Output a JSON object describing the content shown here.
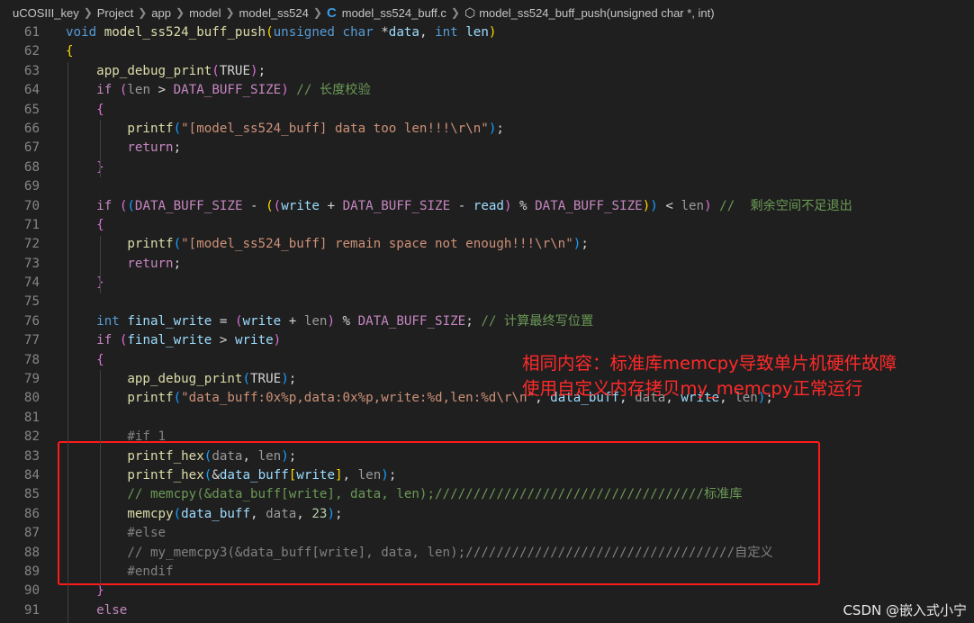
{
  "breadcrumb": {
    "segments": [
      "uCOSIII_key",
      "Project",
      "app",
      "model",
      "model_ss524",
      "model_ss524_buff.c",
      "model_ss524_buff_push(unsigned char *, int)"
    ]
  },
  "code": [
    {
      "n": "61",
      "t": [
        [
          "kw",
          "void"
        ],
        [
          "plain",
          " "
        ],
        [
          "fnn",
          "model_ss524_buff_push"
        ],
        [
          "brk1",
          "("
        ],
        [
          "kw",
          "unsigned"
        ],
        [
          "plain",
          " "
        ],
        [
          "kw",
          "char"
        ],
        [
          "plain",
          " *"
        ],
        [
          "var",
          "data"
        ],
        [
          "plain",
          ", "
        ],
        [
          "kw",
          "int"
        ],
        [
          "plain",
          " "
        ],
        [
          "var",
          "len"
        ],
        [
          "brk1",
          ")"
        ]
      ]
    },
    {
      "n": "62",
      "t": [
        [
          "brk1",
          "{"
        ]
      ]
    },
    {
      "n": "63",
      "t": [
        [
          "plain",
          "    "
        ],
        [
          "fnn",
          "app_debug_print"
        ],
        [
          "brk2",
          "("
        ],
        [
          "plain",
          "TRUE"
        ],
        [
          "brk2",
          ")"
        ],
        [
          "plain",
          ";"
        ]
      ]
    },
    {
      "n": "64",
      "t": [
        [
          "plain",
          "    "
        ],
        [
          "ctl",
          "if"
        ],
        [
          "plain",
          " "
        ],
        [
          "brk2",
          "("
        ],
        [
          "dim",
          "len"
        ],
        [
          "plain",
          " > "
        ],
        [
          "mac",
          "DATA_BUFF_SIZE"
        ],
        [
          "brk2",
          ")"
        ],
        [
          "plain",
          " "
        ],
        [
          "cmt",
          "// 长度校验"
        ]
      ]
    },
    {
      "n": "65",
      "t": [
        [
          "plain",
          "    "
        ],
        [
          "brk2",
          "{"
        ]
      ]
    },
    {
      "n": "66",
      "t": [
        [
          "plain",
          "        "
        ],
        [
          "fnn",
          "printf"
        ],
        [
          "brk3",
          "("
        ],
        [
          "str",
          "\"[model_ss524_buff] data too len!!!\\r\\n\""
        ],
        [
          "brk3",
          ")"
        ],
        [
          "plain",
          ";"
        ]
      ]
    },
    {
      "n": "67",
      "t": [
        [
          "plain",
          "        "
        ],
        [
          "ctl",
          "return"
        ],
        [
          "plain",
          ";"
        ]
      ]
    },
    {
      "n": "68",
      "t": [
        [
          "plain",
          "    "
        ],
        [
          "brk2",
          "}"
        ]
      ]
    },
    {
      "n": "69",
      "t": []
    },
    {
      "n": "70",
      "t": [
        [
          "plain",
          "    "
        ],
        [
          "ctl",
          "if"
        ],
        [
          "plain",
          " "
        ],
        [
          "brk2",
          "("
        ],
        [
          "brk3",
          "("
        ],
        [
          "mac",
          "DATA_BUFF_SIZE"
        ],
        [
          "plain",
          " - "
        ],
        [
          "brk1",
          "("
        ],
        [
          "brk2",
          "("
        ],
        [
          "var",
          "write"
        ],
        [
          "plain",
          " + "
        ],
        [
          "mac",
          "DATA_BUFF_SIZE"
        ],
        [
          "plain",
          " - "
        ],
        [
          "var",
          "read"
        ],
        [
          "brk2",
          ")"
        ],
        [
          "plain",
          " % "
        ],
        [
          "mac",
          "DATA_BUFF_SIZE"
        ],
        [
          "brk1",
          ")"
        ],
        [
          "brk3",
          ")"
        ],
        [
          "plain",
          " < "
        ],
        [
          "dim",
          "len"
        ],
        [
          "brk2",
          ")"
        ],
        [
          "plain",
          " "
        ],
        [
          "cmt",
          "//  剩余空间不足退出"
        ]
      ]
    },
    {
      "n": "71",
      "t": [
        [
          "plain",
          "    "
        ],
        [
          "brk2",
          "{"
        ]
      ]
    },
    {
      "n": "72",
      "t": [
        [
          "plain",
          "        "
        ],
        [
          "fnn",
          "printf"
        ],
        [
          "brk3",
          "("
        ],
        [
          "str",
          "\"[model_ss524_buff] remain space not enough!!!\\r\\n\""
        ],
        [
          "brk3",
          ")"
        ],
        [
          "plain",
          ";"
        ]
      ]
    },
    {
      "n": "73",
      "t": [
        [
          "plain",
          "        "
        ],
        [
          "ctl",
          "return"
        ],
        [
          "plain",
          ";"
        ]
      ]
    },
    {
      "n": "74",
      "t": [
        [
          "plain",
          "    "
        ],
        [
          "brk2",
          "}"
        ]
      ]
    },
    {
      "n": "75",
      "t": []
    },
    {
      "n": "76",
      "t": [
        [
          "plain",
          "    "
        ],
        [
          "kw",
          "int"
        ],
        [
          "plain",
          " "
        ],
        [
          "var",
          "final_write"
        ],
        [
          "plain",
          " = "
        ],
        [
          "brk2",
          "("
        ],
        [
          "var",
          "write"
        ],
        [
          "plain",
          " + "
        ],
        [
          "dim",
          "len"
        ],
        [
          "brk2",
          ")"
        ],
        [
          "plain",
          " % "
        ],
        [
          "mac",
          "DATA_BUFF_SIZE"
        ],
        [
          "plain",
          "; "
        ],
        [
          "cmt",
          "// 计算最终写位置"
        ]
      ]
    },
    {
      "n": "77",
      "t": [
        [
          "plain",
          "    "
        ],
        [
          "ctl",
          "if"
        ],
        [
          "plain",
          " "
        ],
        [
          "brk2",
          "("
        ],
        [
          "var",
          "final_write"
        ],
        [
          "plain",
          " > "
        ],
        [
          "var",
          "write"
        ],
        [
          "brk2",
          ")"
        ]
      ]
    },
    {
      "n": "78",
      "t": [
        [
          "plain",
          "    "
        ],
        [
          "brk2",
          "{"
        ]
      ]
    },
    {
      "n": "79",
      "t": [
        [
          "plain",
          "        "
        ],
        [
          "fnn",
          "app_debug_print"
        ],
        [
          "brk3",
          "("
        ],
        [
          "plain",
          "TRUE"
        ],
        [
          "brk3",
          ")"
        ],
        [
          "plain",
          ";"
        ]
      ]
    },
    {
      "n": "80",
      "t": [
        [
          "plain",
          "        "
        ],
        [
          "fnn",
          "printf"
        ],
        [
          "brk3",
          "("
        ],
        [
          "str",
          "\"data_buff:0x%p,data:0x%p,write:%d,len:%d\\r\\n\""
        ],
        [
          "plain",
          ", "
        ],
        [
          "var",
          "data_buff"
        ],
        [
          "plain",
          ", "
        ],
        [
          "dim",
          "data"
        ],
        [
          "plain",
          ", "
        ],
        [
          "var",
          "write"
        ],
        [
          "plain",
          ", "
        ],
        [
          "dim",
          "len"
        ],
        [
          "brk3",
          ")"
        ],
        [
          "plain",
          ";"
        ]
      ]
    },
    {
      "n": "81",
      "t": []
    },
    {
      "n": "82",
      "t": [
        [
          "plain",
          "        "
        ],
        [
          "inact",
          "#if 1"
        ]
      ]
    },
    {
      "n": "83",
      "t": [
        [
          "plain",
          "        "
        ],
        [
          "fnn",
          "printf_hex"
        ],
        [
          "brk3",
          "("
        ],
        [
          "dim",
          "data"
        ],
        [
          "plain",
          ", "
        ],
        [
          "dim",
          "len"
        ],
        [
          "brk3",
          ")"
        ],
        [
          "plain",
          ";"
        ]
      ]
    },
    {
      "n": "84",
      "t": [
        [
          "plain",
          "        "
        ],
        [
          "fnn",
          "printf_hex"
        ],
        [
          "brk3",
          "("
        ],
        [
          "plain",
          "&"
        ],
        [
          "var",
          "data_buff"
        ],
        [
          "brk1",
          "["
        ],
        [
          "var",
          "write"
        ],
        [
          "brk1",
          "]"
        ],
        [
          "plain",
          ", "
        ],
        [
          "dim",
          "len"
        ],
        [
          "brk3",
          ")"
        ],
        [
          "plain",
          ";"
        ]
      ]
    },
    {
      "n": "85",
      "t": [
        [
          "plain",
          "        "
        ],
        [
          "cmt",
          "// memcpy(&data_buff[write], data, len);///////////////////////////////////标准库"
        ]
      ]
    },
    {
      "n": "86",
      "t": [
        [
          "plain",
          "        "
        ],
        [
          "fnn",
          "memcpy"
        ],
        [
          "brk3",
          "("
        ],
        [
          "var",
          "data_buff"
        ],
        [
          "plain",
          ", "
        ],
        [
          "dim",
          "data"
        ],
        [
          "plain",
          ", "
        ],
        [
          "num",
          "23"
        ],
        [
          "brk3",
          ")"
        ],
        [
          "plain",
          ";"
        ]
      ]
    },
    {
      "n": "87",
      "t": [
        [
          "plain",
          "        "
        ],
        [
          "inact",
          "#else"
        ]
      ]
    },
    {
      "n": "88",
      "t": [
        [
          "plain",
          "        "
        ],
        [
          "inact",
          "// my_memcpy3(&data_buff[write], data, len);///////////////////////////////////自定义"
        ]
      ]
    },
    {
      "n": "89",
      "t": [
        [
          "plain",
          "        "
        ],
        [
          "inact",
          "#endif"
        ]
      ]
    },
    {
      "n": "90",
      "t": [
        [
          "plain",
          "    "
        ],
        [
          "brk2",
          "}"
        ]
      ]
    },
    {
      "n": "91",
      "t": [
        [
          "plain",
          "    "
        ],
        [
          "ctl",
          "else"
        ]
      ]
    }
  ],
  "annotation": {
    "line1": "相同内容：标准库memcpy导致单片机硬件故障",
    "line2": "使用自定义内存拷贝my_memcpy正常运行"
  },
  "watermark": "CSDN @嵌入式小宁",
  "colors": {
    "annotation": "#ff2a2a",
    "box": "#ff1a1a"
  }
}
